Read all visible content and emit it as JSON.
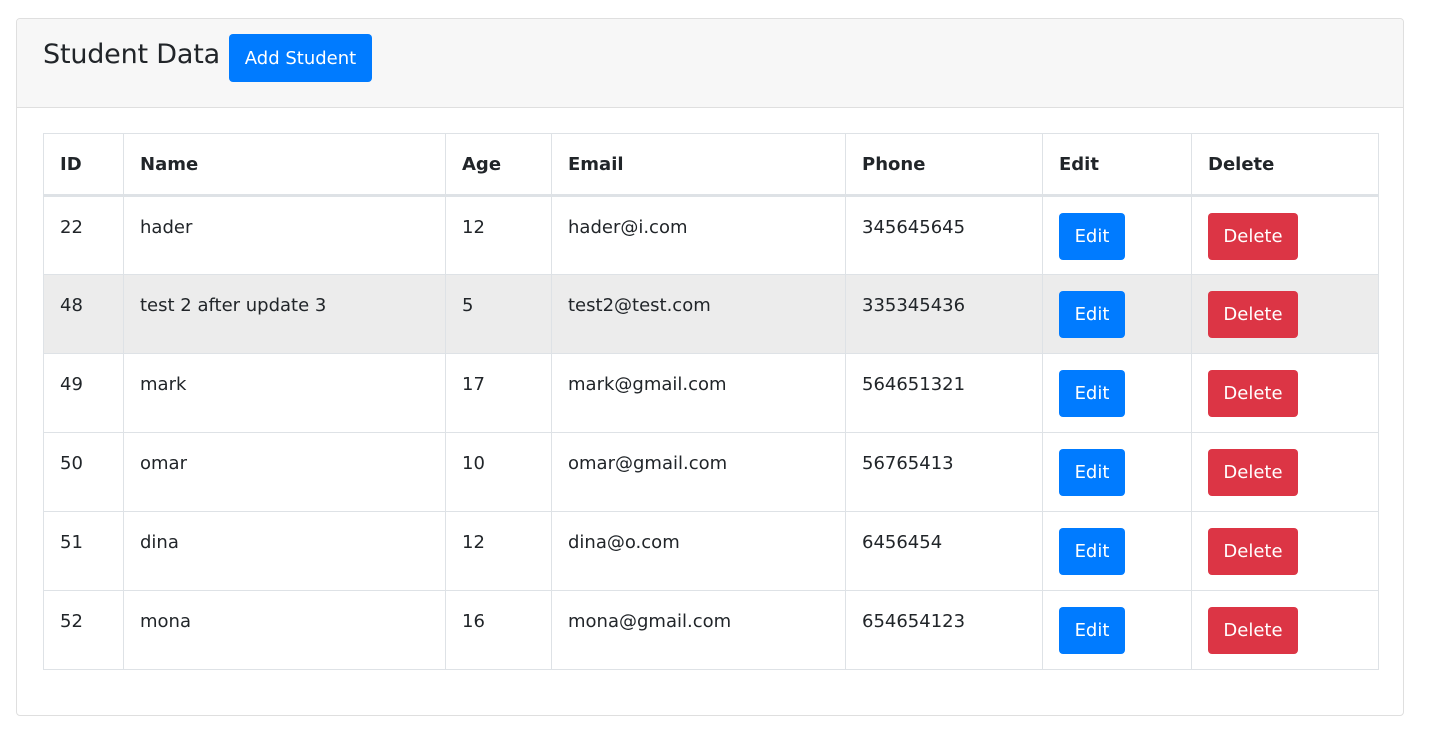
{
  "header": {
    "title": "Student Data",
    "add_button_label": "Add Student"
  },
  "table": {
    "columns": [
      "ID",
      "Name",
      "Age",
      "Email",
      "Phone",
      "Edit",
      "Delete"
    ],
    "rows": [
      {
        "id": "22",
        "name": "hader",
        "age": "12",
        "email": "hader@i.com",
        "phone": "345645645",
        "edit": "Edit",
        "delete": "Delete"
      },
      {
        "id": "48",
        "name": "test 2 after update 3",
        "age": "5",
        "email": "test2@test.com",
        "phone": "335345436",
        "edit": "Edit",
        "delete": "Delete"
      },
      {
        "id": "49",
        "name": "mark",
        "age": "17",
        "email": "mark@gmail.com",
        "phone": "564651321",
        "edit": "Edit",
        "delete": "Delete"
      },
      {
        "id": "50",
        "name": "omar",
        "age": "10",
        "email": "omar@gmail.com",
        "phone": "56765413",
        "edit": "Edit",
        "delete": "Delete"
      },
      {
        "id": "51",
        "name": "dina",
        "age": "12",
        "email": "dina@o.com",
        "phone": "6456454",
        "edit": "Edit",
        "delete": "Delete"
      },
      {
        "id": "52",
        "name": "mona",
        "age": "16",
        "email": "mona@gmail.com",
        "phone": "654654123",
        "edit": "Edit",
        "delete": "Delete"
      }
    ]
  },
  "colors": {
    "primary": "#007bff",
    "danger": "#dc3545",
    "hover_row": "#ececec"
  }
}
